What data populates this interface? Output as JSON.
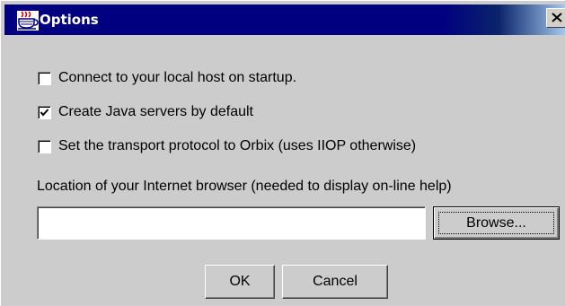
{
  "window": {
    "title": "Options",
    "icon": "java-coffee-cup-icon",
    "close_icon": "close-icon"
  },
  "options": {
    "connect_local_host": {
      "label": "Connect to your local host on startup.",
      "checked": false
    },
    "create_java_servers": {
      "label": "Create Java servers by default",
      "checked": true
    },
    "transport_orbix": {
      "label": "Set the transport protocol to Orbix (uses IIOP otherwise)",
      "checked": false
    }
  },
  "browser": {
    "label": "Location of your Internet browser (needed to display on-line help)",
    "value": "",
    "browse_label": "Browse..."
  },
  "buttons": {
    "ok_label": "OK",
    "cancel_label": "Cancel"
  },
  "colors": {
    "titlebar": "#000080",
    "dialog_background": "#cccccc"
  }
}
